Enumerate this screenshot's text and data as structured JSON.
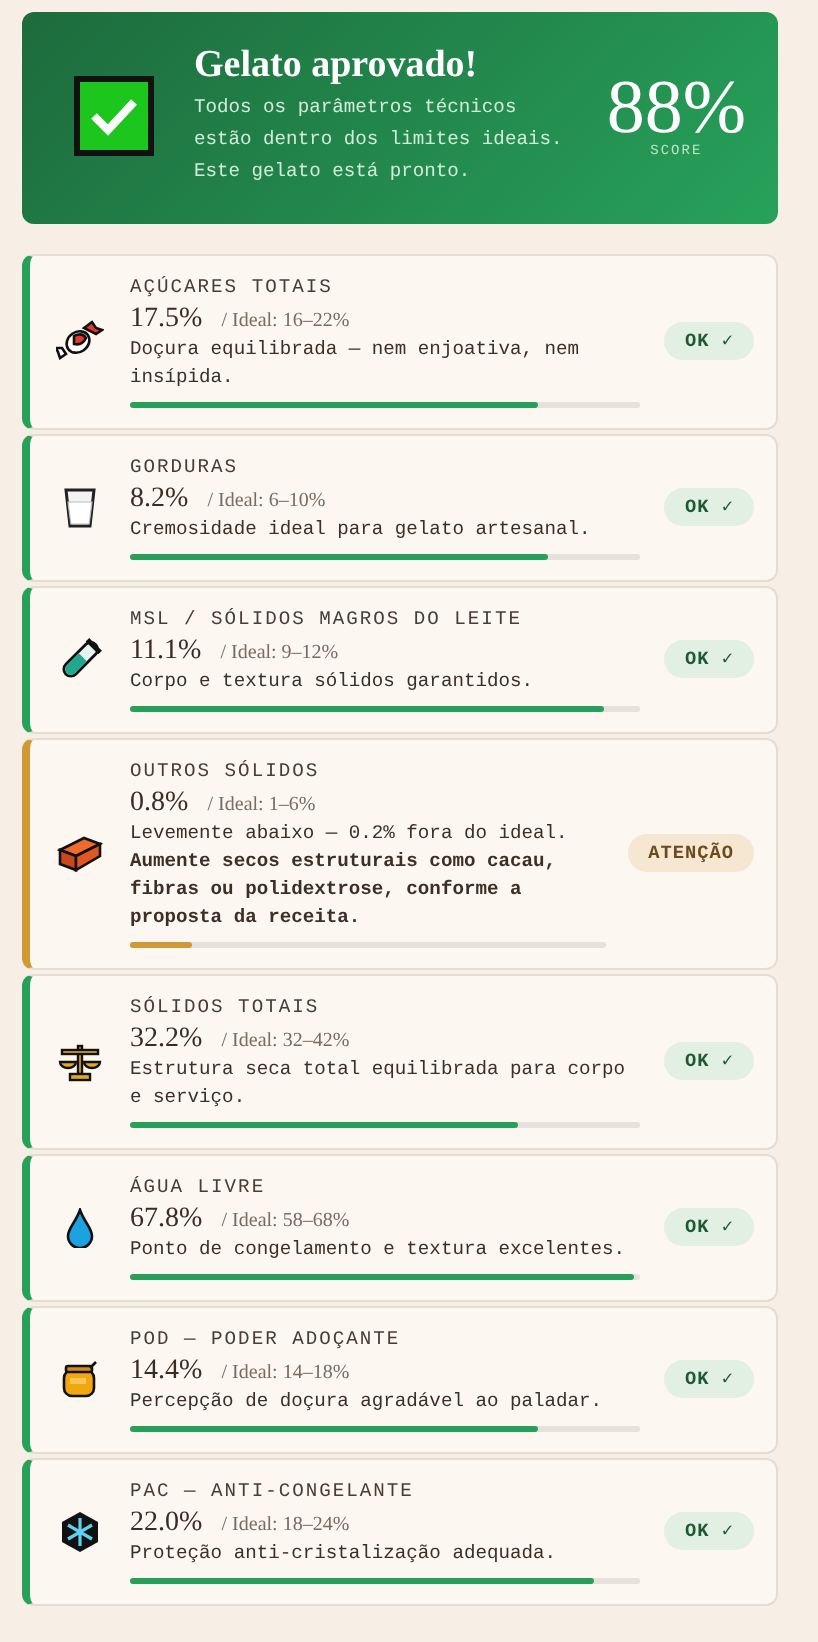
{
  "summary": {
    "title": "Gelato aprovado!",
    "message": "Todos os parâmetros técnicos estão dentro dos limites ideais. Este gelato está pronto.",
    "score": "88%",
    "score_label": "SCORE"
  },
  "parameters": [
    {
      "name": "AÇÚCARES TOTAIS",
      "value": "17.5%",
      "ideal": "/ Ideal: 16–22%",
      "description": "Doçura equilibrada — nem enjoativa, nem insípida.",
      "kind": "ok",
      "badge": "OK ✓",
      "level": 0.8
    },
    {
      "name": "GORDURAS",
      "value": "8.2%",
      "ideal": "/ Ideal: 6–10%",
      "description": "Cremosidade ideal para gelato artesanal.",
      "kind": "ok",
      "badge": "OK ✓",
      "level": 0.82
    },
    {
      "name": "MSL / SÓLIDOS MAGROS DO LEITE",
      "value": "11.1%",
      "ideal": "/ Ideal: 9–12%",
      "description": "Corpo e textura sólidos garantidos.",
      "kind": "ok",
      "badge": "OK ✓",
      "level": 0.93
    },
    {
      "name": "OUTROS SÓLIDOS",
      "value": "0.8%",
      "ideal": "/ Ideal: 1–6%",
      "description": "Levemente abaixo — 0.2% fora do ideal. **Aumente secos estruturais como cacau, fibras ou polidextrose, conforme a proposta da receita.**",
      "kind": "warn",
      "badge": "ATENÇÃO",
      "level": 0.13
    },
    {
      "name": "SÓLIDOS TOTAIS",
      "value": "32.2%",
      "ideal": "/ Ideal: 32–42%",
      "description": "Estrutura seca total equilibrada para corpo e serviço.",
      "kind": "ok",
      "badge": "OK ✓",
      "level": 0.76
    },
    {
      "name": "ÁGUA LIVRE",
      "value": "67.8%",
      "ideal": "/ Ideal: 58–68%",
      "description": "Ponto de congelamento e textura excelentes.",
      "kind": "ok",
      "badge": "OK ✓",
      "level": 0.99
    },
    {
      "name": "POD — PODER ADOÇANTE",
      "value": "14.4%",
      "ideal": "/ Ideal: 14–18%",
      "description": "Percepção de doçura agradável ao paladar.",
      "kind": "ok",
      "badge": "OK ✓",
      "level": 0.8
    },
    {
      "name": "PAC — ANTI-CONGELANTE",
      "value": "22.0%",
      "ideal": "/ Ideal: 18–24%",
      "description": "Proteção anti-cristalização adequada.",
      "kind": "ok",
      "badge": "OK ✓",
      "level": 0.91
    }
  ]
}
